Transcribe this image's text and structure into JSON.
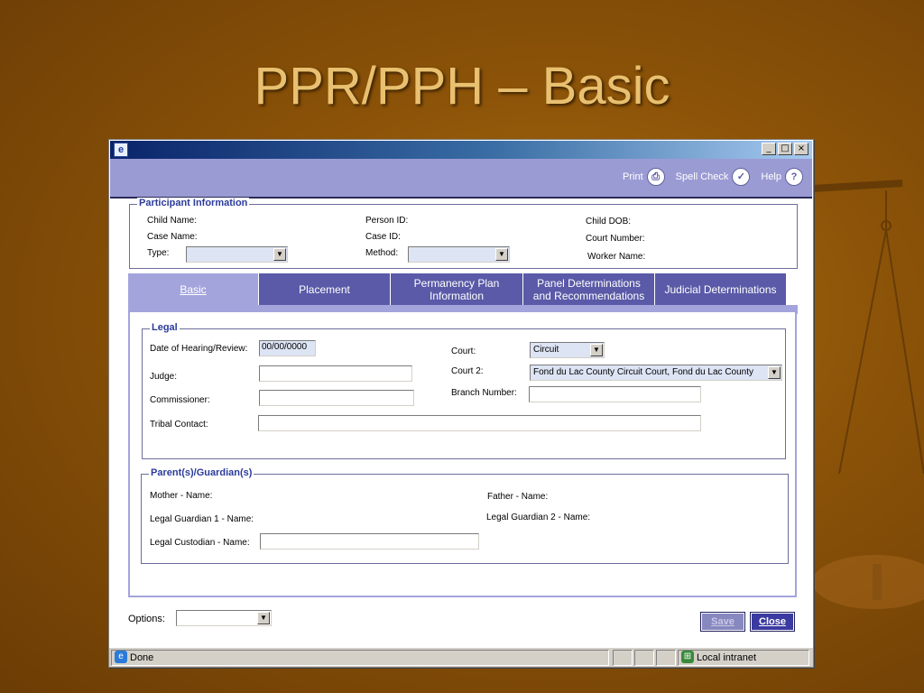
{
  "slide": {
    "title": "PPR/PPH – Basic"
  },
  "window": {
    "app_icon": "ie-page-icon",
    "controls": {
      "minimize": "_",
      "maximize": "□",
      "close": "×"
    }
  },
  "toolbar": {
    "print_label": "Print",
    "print_icon": "printer-icon",
    "spellcheck_label": "Spell Check",
    "spellcheck_icon": "spellcheck-icon",
    "help_label": "Help",
    "help_icon": "help-icon"
  },
  "participant": {
    "legend": "Participant Information",
    "child_name_label": "Child Name:",
    "case_name_label": "Case Name:",
    "type_label": "Type:",
    "person_id_label": "Person ID:",
    "case_id_label": "Case ID:",
    "method_label": "Method:",
    "child_dob_label": "Child DOB:",
    "court_number_label": "Court Number:",
    "worker_name_label": "Worker Name:",
    "type_value": "",
    "method_value": ""
  },
  "tabs": [
    {
      "label": "Basic",
      "active": true
    },
    {
      "label": "Placement"
    },
    {
      "label_line1": "Permanency Plan",
      "label_line2": "Information"
    },
    {
      "label_line1": "Panel Determinations",
      "label_line2": "and Recommendations"
    },
    {
      "label": "Judicial Determinations"
    }
  ],
  "legal": {
    "legend": "Legal",
    "date_label": "Date of Hearing/Review:",
    "date_value": "00/00/0000",
    "judge_label": "Judge:",
    "commissioner_label": "Commissioner:",
    "tribal_label": "Tribal Contact:",
    "court_label": "Court:",
    "court_value": "Circuit",
    "court2_label": "Court 2:",
    "court2_value": "Fond du Lac County Circuit Court, Fond du Lac County",
    "branch_label": "Branch Number:",
    "judge_value": "",
    "commissioner_value": "",
    "tribal_value": "",
    "branch_value": ""
  },
  "guardians": {
    "legend": "Parent(s)/Guardian(s)",
    "mother_label": "Mother - Name:",
    "father_label": "Father - Name:",
    "lg1_label": "Legal Guardian 1 - Name:",
    "lg2_label": "Legal Guardian 2 - Name:",
    "custodian_label": "Legal Custodian - Name:",
    "custodian_value": ""
  },
  "footer": {
    "options_label": "Options:",
    "options_value": "",
    "save_label": "Save",
    "close_label": "Close"
  },
  "status": {
    "text": "Done",
    "zone": "Local intranet"
  }
}
